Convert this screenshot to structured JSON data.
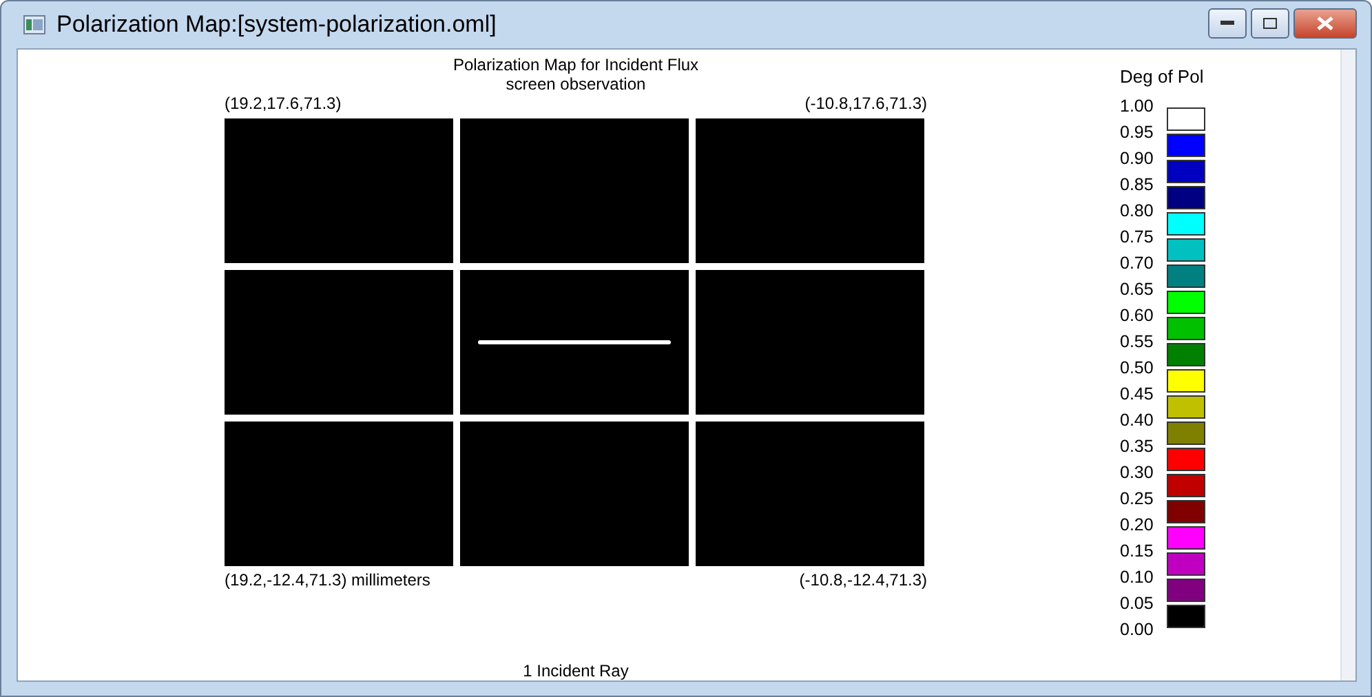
{
  "window": {
    "title": "Polarization Map:[system-polarization.oml]"
  },
  "plot": {
    "title": "Polarization Map for Incident Flux",
    "subtitle": "screen observation",
    "top_left": "(19.2,17.6,71.3)",
    "top_right": "(-10.8,17.6,71.3)",
    "bottom_left": "(19.2,-12.4,71.3) millimeters",
    "bottom_right": "(-10.8,-12.4,71.3)",
    "cells": [
      {
        "kind": "empty"
      },
      {
        "kind": "empty"
      },
      {
        "kind": "empty"
      },
      {
        "kind": "empty"
      },
      {
        "kind": "line"
      },
      {
        "kind": "empty"
      },
      {
        "kind": "empty"
      },
      {
        "kind": "empty"
      },
      {
        "kind": "empty"
      }
    ],
    "footer": "1 Incident Ray"
  },
  "legend": {
    "title": "Deg of Pol",
    "ticks": [
      "1.00",
      "0.95",
      "0.90",
      "0.85",
      "0.80",
      "0.75",
      "0.70",
      "0.65",
      "0.60",
      "0.55",
      "0.50",
      "0.45",
      "0.40",
      "0.35",
      "0.30",
      "0.25",
      "0.20",
      "0.15",
      "0.10",
      "0.05",
      "0.00"
    ],
    "swatches": [
      {
        "color": "#ffffff"
      },
      {
        "color": "#0000ff"
      },
      {
        "color": "#0000c0"
      },
      {
        "color": "#000080"
      },
      {
        "color": "#00ffff"
      },
      {
        "color": "#00c0c0"
      },
      {
        "color": "#008080"
      },
      {
        "color": "#00ff00"
      },
      {
        "color": "#00c000"
      },
      {
        "color": "#008000"
      },
      {
        "color": "#ffff00"
      },
      {
        "color": "#c0c000"
      },
      {
        "color": "#808000"
      },
      {
        "color": "#ff0000"
      },
      {
        "color": "#c00000"
      },
      {
        "color": "#800000"
      },
      {
        "color": "#ff00ff"
      },
      {
        "color": "#c000c0"
      },
      {
        "color": "#800080"
      },
      {
        "color": "#000000"
      }
    ]
  }
}
